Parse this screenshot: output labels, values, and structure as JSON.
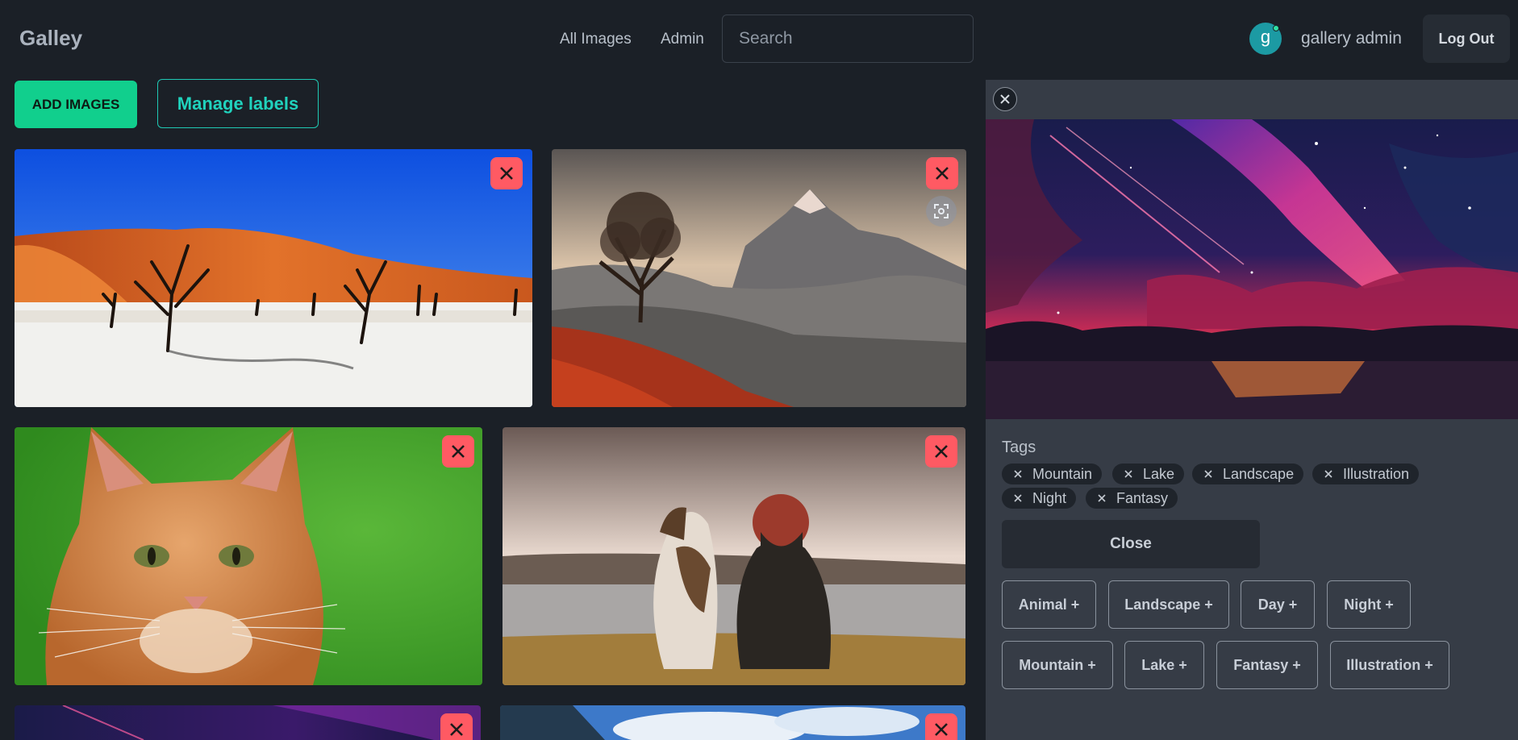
{
  "header": {
    "brand": "Galley",
    "nav": [
      {
        "label": "All Images"
      },
      {
        "label": "Admin"
      }
    ],
    "search": {
      "placeholder": "Search",
      "value": ""
    },
    "user": {
      "initial": "g",
      "name": "gallery admin",
      "status_color": "#2fe0a4"
    },
    "logout_label": "Log Out"
  },
  "toolbar": {
    "add_images_label": "ADD IMAGES",
    "manage_labels_label": "Manage labels"
  },
  "colors": {
    "accent_green": "#11cf8d",
    "accent_teal": "#20d2bd",
    "delete_red": "#ff5a63",
    "background": "#1b2027",
    "panel": "#363c46"
  },
  "gallery": {
    "images": [
      {
        "subject": "desert-dunes-trees",
        "delete_icon": "close-icon"
      },
      {
        "subject": "tree-mountain-sunset",
        "delete_icon": "close-icon",
        "focus_icon": "focus-frame-icon"
      },
      {
        "subject": "orange-cat",
        "delete_icon": "close-icon"
      },
      {
        "subject": "dog-and-woman-lake",
        "delete_icon": "close-icon"
      },
      {
        "subject": "fantasy-night-sky",
        "delete_icon": "close-icon"
      },
      {
        "subject": "mountain-blue-sky",
        "delete_icon": "close-icon"
      }
    ]
  },
  "detail_panel": {
    "close_icon": "close-icon",
    "image_subject": "fantasy-night-sky",
    "tags_label": "Tags",
    "tags": [
      "Mountain",
      "Lake",
      "Landscape",
      "Illustration",
      "Night",
      "Fantasy"
    ],
    "close_label": "Close",
    "available_tags": [
      "Animal +",
      "Landscape +",
      "Day +",
      "Night +",
      "Mountain +",
      "Lake +",
      "Fantasy +",
      "Illustration +"
    ]
  }
}
